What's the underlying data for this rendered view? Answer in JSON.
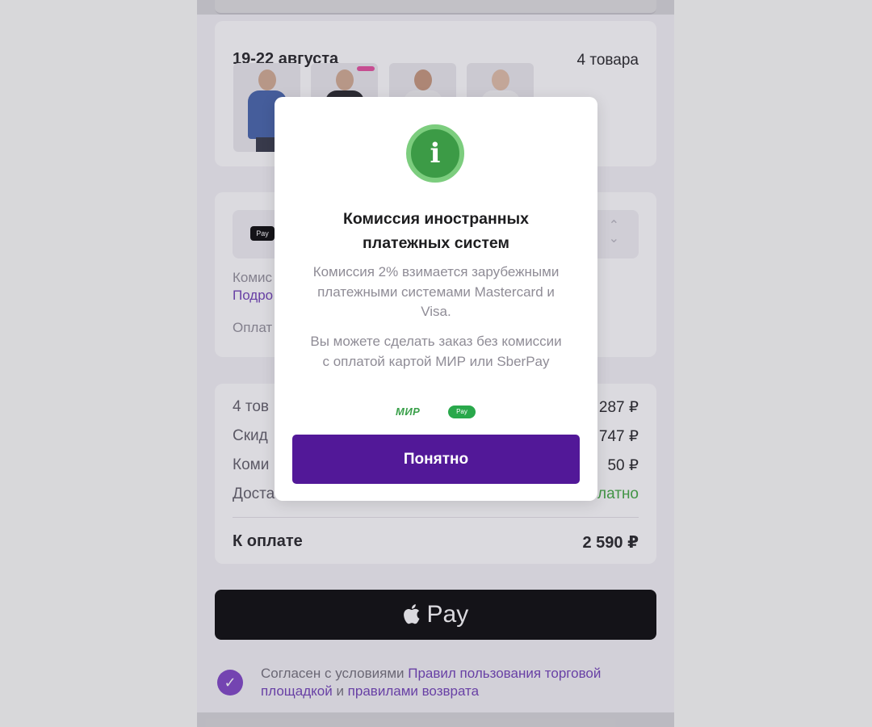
{
  "order": {
    "delivery_date": "19-22 августа",
    "items_count": "4 товара",
    "thumbnails": [
      {
        "shirt_color": "#3f5fa8"
      },
      {
        "shirt_color": "#1e1e22"
      },
      {
        "shirt_color": "#f3f3f3"
      },
      {
        "shirt_color": "#f6f6f6"
      }
    ]
  },
  "payment": {
    "method_chip": "Pay",
    "chevron": "⌃⌄",
    "commission_text": "Комис",
    "details_link": "Подро",
    "pay_text": "Оплат"
  },
  "summary": {
    "rows": [
      {
        "label": "4 тов",
        "value": "287 ₽"
      },
      {
        "label": "Скид",
        "value": "747 ₽"
      },
      {
        "label": "Коми",
        "value": "50 ₽"
      },
      {
        "label": "Доста",
        "value": "латно"
      }
    ],
    "total_label": "К оплате",
    "total_value": "2 590 ₽"
  },
  "applepay": {
    "label": "Pay"
  },
  "agreement": {
    "prefix": "Согласен с условиями ",
    "link1": "Правил пользования торговой площадкой",
    "middle": " и ",
    "link2": "правилами возврата"
  },
  "modal": {
    "icon": "i",
    "title": "Комиссия иностранных платежных систем",
    "paragraph1": "Комиссия 2% взимается зарубежными платежными системами Mastercard и Visa.",
    "paragraph2": "Вы можете сделать заказ без комиссии с оплатой картой МИР или SberPay",
    "logo_mir": "МИР",
    "logo_sberpay": "Pay",
    "button_label": "Понятно"
  },
  "colors": {
    "accent": "#521898",
    "success": "#3c9b46",
    "link": "#6c3ab5"
  }
}
